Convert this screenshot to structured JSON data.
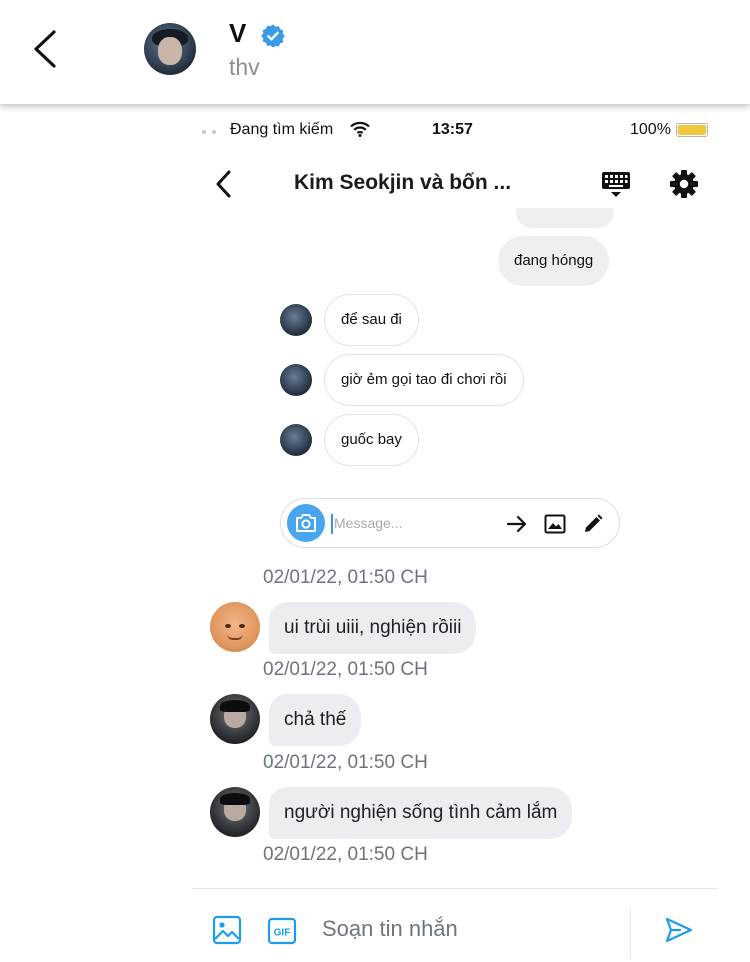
{
  "header": {
    "name": "V",
    "handle": "thv",
    "icons": [
      "back-arrow-icon",
      "verified-badge-icon"
    ],
    "accent": "#3b9ae8"
  },
  "embedded_screenshot": {
    "status_bar": {
      "carrier": "Đang tìm kiếm",
      "time": "13:57",
      "battery": "100%",
      "battery_level": 1.0,
      "battery_color": "#f2c93d"
    },
    "dm_header": {
      "title": "Kim Seokjin và bốn ...",
      "icons": [
        "back-chevron-icon",
        "keyboard-icon",
        "settings-gear-icon"
      ]
    },
    "outgoing_message": "đang hóngg",
    "incoming_messages": [
      "để sau đi",
      "giờ ẻm gọi tao đi chơi rồi",
      "guốc bay"
    ],
    "message_input": {
      "placeholder": "Message...",
      "icons": [
        "camera-icon",
        "send-arrow-icon",
        "gallery-icon",
        "pencil-icon"
      ]
    }
  },
  "conversation": {
    "timestamps": [
      "02/01/22, 01:50 CH",
      "02/01/22, 01:50 CH",
      "02/01/22, 01:50 CH",
      "02/01/22, 01:50 CH"
    ],
    "replies": [
      {
        "text": "ui trùi uiii, nghiện rồiii",
        "avatar": "cartoon-face"
      },
      {
        "text": "chả thế",
        "avatar": "dark-photo"
      },
      {
        "text": "người nghiện sống tình cảm lắm",
        "avatar": "dark-photo"
      }
    ],
    "bubble_color": "#ebedf0"
  },
  "composer": {
    "placeholder": "Soạn tin nhắn",
    "icons": [
      "image-icon",
      "gif-icon",
      "send-icon"
    ],
    "accent": "#1d9bf0"
  }
}
